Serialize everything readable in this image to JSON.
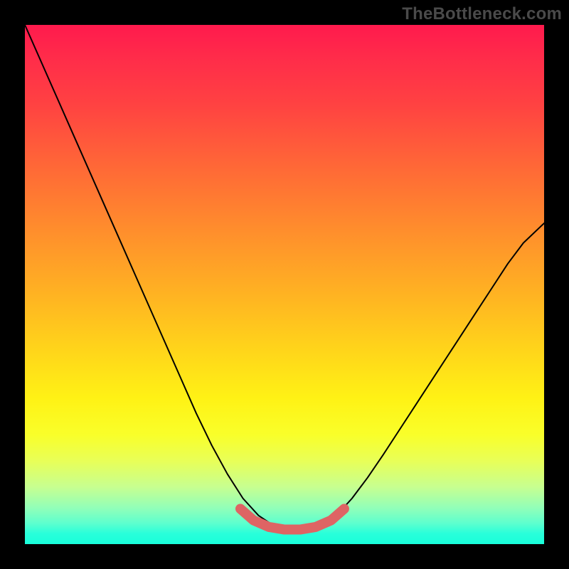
{
  "watermark": "TheBottleneck.com",
  "chart_data": {
    "type": "line",
    "title": "",
    "xlabel": "",
    "ylabel": "",
    "xlim": [
      0,
      1
    ],
    "ylim": [
      0,
      1
    ],
    "series": [
      {
        "name": "black-curve",
        "color": "#000000",
        "stroke_width": 2,
        "x": [
          0.0,
          0.03,
          0.06,
          0.09,
          0.12,
          0.15,
          0.18,
          0.21,
          0.24,
          0.27,
          0.3,
          0.33,
          0.36,
          0.39,
          0.42,
          0.45,
          0.48,
          0.51,
          0.54,
          0.57,
          0.6,
          0.63,
          0.66,
          0.69,
          0.72,
          0.75,
          0.78,
          0.81,
          0.84,
          0.87,
          0.9,
          0.93,
          0.96,
          1.0
        ],
        "y": [
          1.0,
          0.932,
          0.864,
          0.796,
          0.728,
          0.66,
          0.592,
          0.524,
          0.456,
          0.388,
          0.32,
          0.252,
          0.19,
          0.135,
          0.088,
          0.055,
          0.035,
          0.028,
          0.028,
          0.035,
          0.055,
          0.088,
          0.128,
          0.172,
          0.218,
          0.264,
          0.31,
          0.356,
          0.402,
          0.448,
          0.494,
          0.54,
          0.58,
          0.618
        ]
      },
      {
        "name": "pink-bottom",
        "color": "#de6464",
        "stroke_width": 14,
        "x": [
          0.415,
          0.44,
          0.47,
          0.5,
          0.53,
          0.56,
          0.59,
          0.615
        ],
        "y": [
          0.068,
          0.046,
          0.033,
          0.028,
          0.028,
          0.033,
          0.046,
          0.068
        ]
      }
    ]
  }
}
